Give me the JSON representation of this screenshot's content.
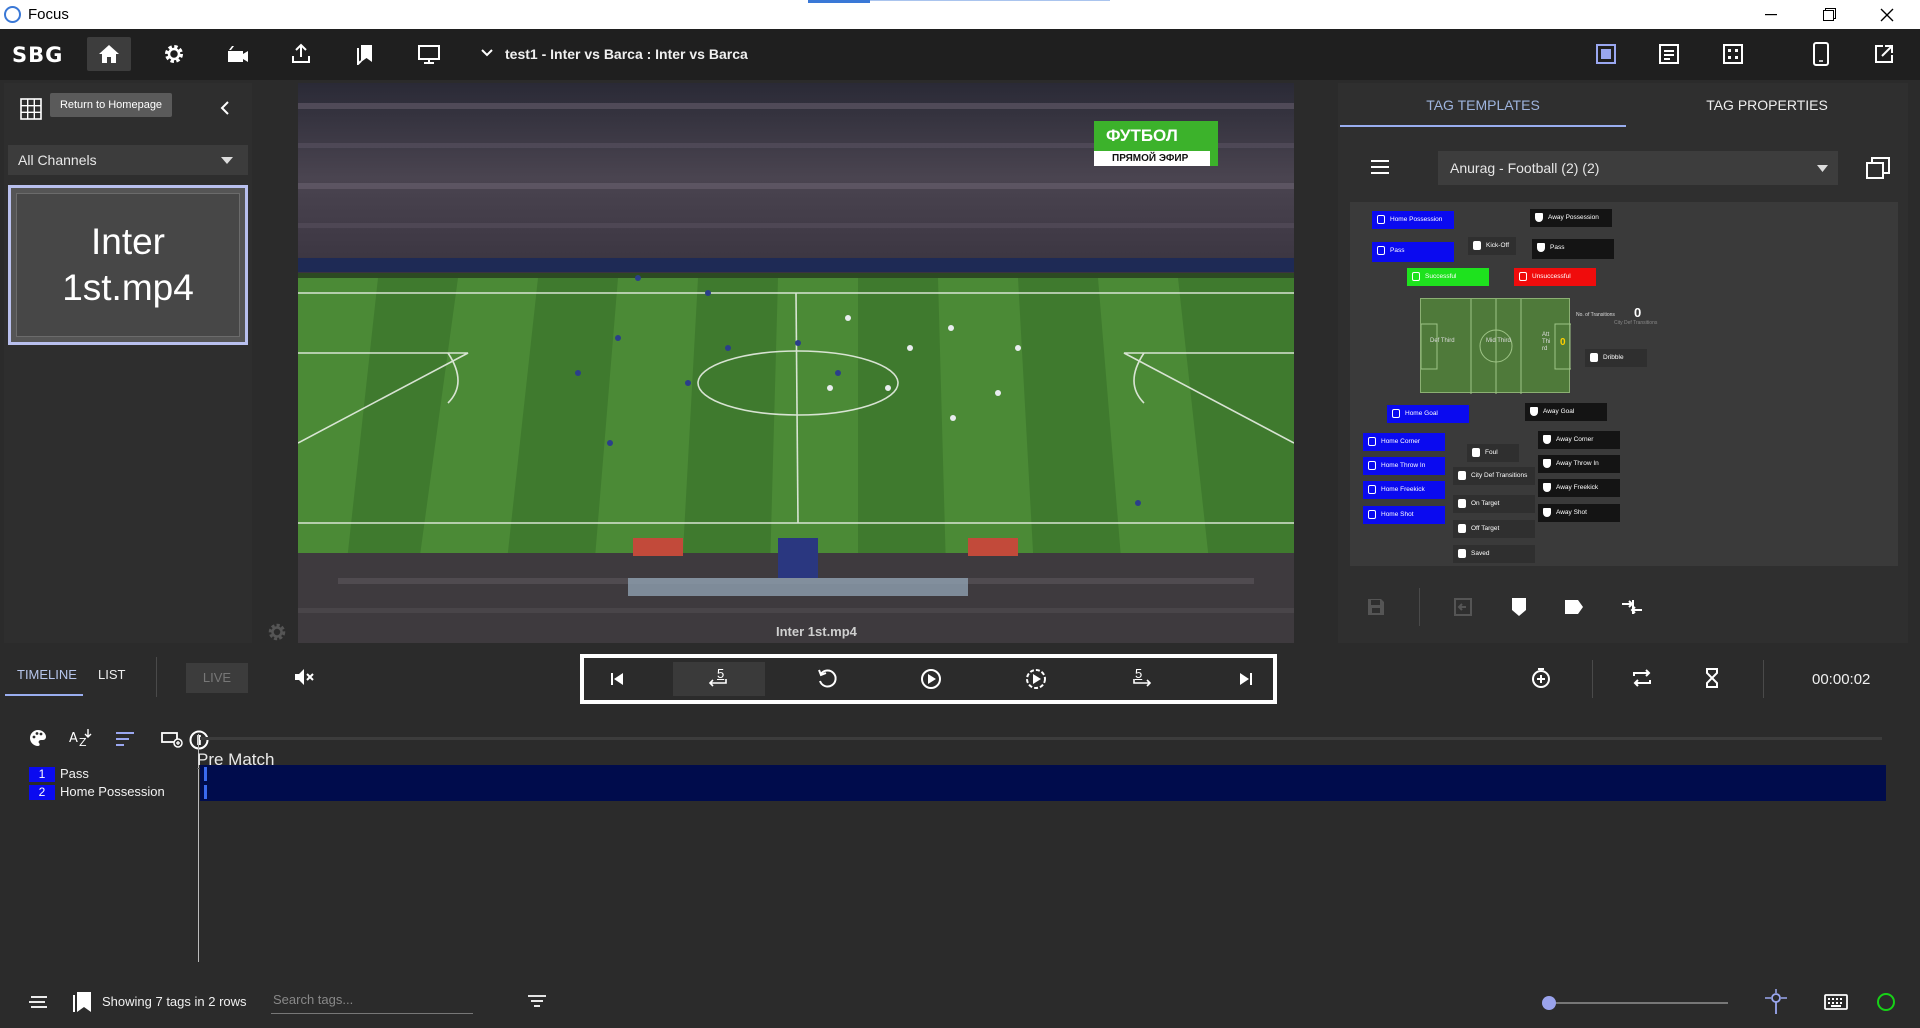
{
  "window": {
    "title": "Focus"
  },
  "toolbar": {
    "logo": "SBG",
    "project_title": "test1 - Inter vs Barca : Inter vs Barca",
    "tooltip": "Return to Homepage"
  },
  "channels": {
    "selected": "All Channels",
    "clip_name": "Inter 1st.mp4"
  },
  "video": {
    "overlay_label": "Inter 1st.mp4",
    "broadcast_badge_top": "ФУТБОЛ",
    "broadcast_badge_bottom": "ПРЯМОЙ ЭФИР"
  },
  "tag_panel": {
    "tabs": [
      "TAG TEMPLATES",
      "TAG PROPERTIES"
    ],
    "template": "Anurag - Football (2) (2)",
    "buttons": {
      "home_possession": "Home Possession",
      "away_possession": "Away Possession",
      "pass_home": "Pass",
      "pass_away": "Pass",
      "kick_off": "Kick-Off",
      "successful": "Successful",
      "unsuccessful": "Unsuccessful",
      "def_third": "Def Third",
      "mid_third": "Mid Third",
      "att_third": "Att Thi rd",
      "transitions_label": "No. of Transitions",
      "transitions_value": "0",
      "transitions_sub": "City Def Transitions",
      "att_third_count": "0",
      "dribble": "Dribble",
      "home_goal": "Home Goal",
      "away_goal": "Away Goal",
      "home_corner": "Home Corner",
      "away_corner": "Away Corner",
      "foul": "Foul",
      "home_throw_in": "Home Throw In",
      "away_throw_in": "Away Throw In",
      "city_def_transitions": "City Def Transitions",
      "home_freekick": "Home Freekick",
      "away_freekick": "Away Freekick",
      "on_target": "On Target",
      "home_shot": "Home Shot",
      "away_shot": "Away Shot",
      "off_target": "Off Target",
      "saved": "Saved"
    }
  },
  "transport": {
    "tabs": [
      "TIMELINE",
      "LIST"
    ],
    "live": "LIVE",
    "skip_back_label": "5",
    "skip_fwd_label": "5",
    "time": "00:00:02"
  },
  "timeline": {
    "phase": "Pre Match",
    "rows": [
      {
        "num": "1",
        "label": "Pass"
      },
      {
        "num": "2",
        "label": "Home Possession"
      }
    ]
  },
  "status": {
    "summary": "Showing 7 tags in 2 rows",
    "search_placeholder": "Search tags..."
  },
  "colors": {
    "accent": "#9aaef0",
    "home_blue": "#0a0af0",
    "success_green": "#1ee21e",
    "fail_red": "#f00c0c",
    "live_green": "#17d117"
  }
}
